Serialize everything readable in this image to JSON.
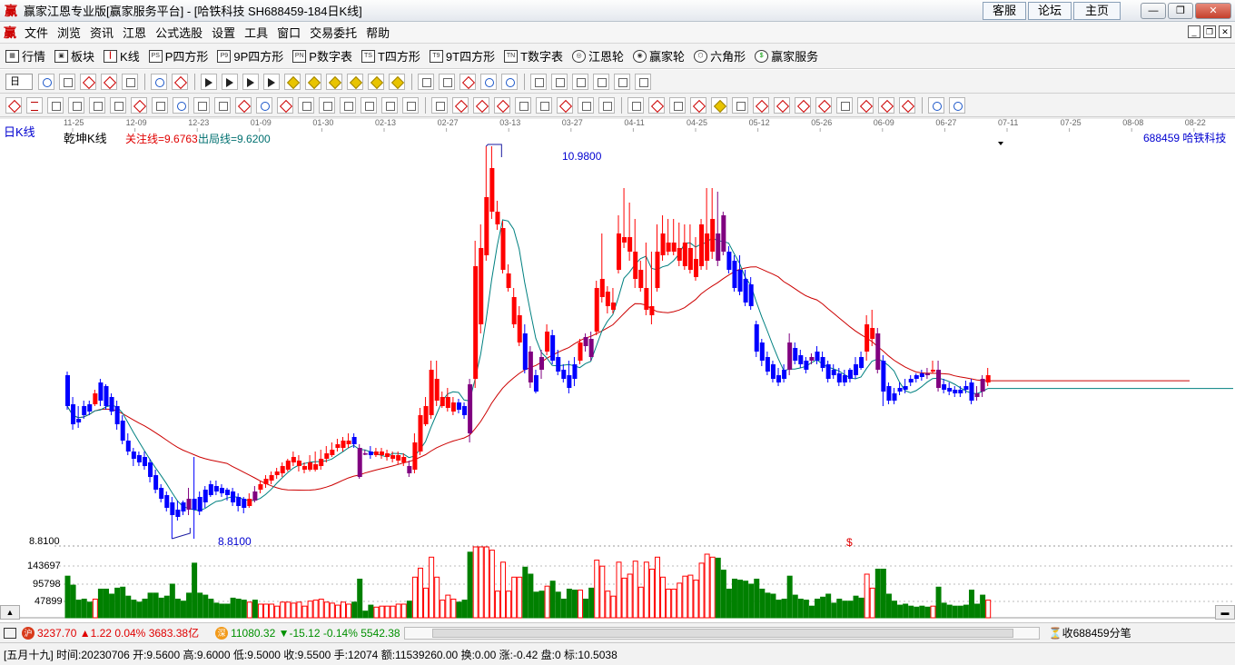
{
  "window": {
    "title": "赢家江恩专业版[赢家服务平台] - [哈铁科技  SH688459-184日K线]",
    "links": [
      "客服",
      "论坛",
      "主页"
    ]
  },
  "menu": [
    "文件",
    "浏览",
    "资讯",
    "江恩",
    "公式选股",
    "设置",
    "工具",
    "窗口",
    "交易委托",
    "帮助"
  ],
  "nav": [
    {
      "label": "行情",
      "icon": "grid-icon"
    },
    {
      "label": "板块",
      "icon": "blocks-icon"
    },
    {
      "label": "K线",
      "icon": "kline-icon"
    },
    {
      "label": "P四方形",
      "icon": "ps-icon"
    },
    {
      "label": "9P四方形",
      "icon": "p9-icon"
    },
    {
      "label": "P数字表",
      "icon": "pn-icon"
    },
    {
      "label": "T四方形",
      "icon": "ts-icon"
    },
    {
      "label": "9T四方形",
      "icon": "t9-icon"
    },
    {
      "label": "T数字表",
      "icon": "tn-icon"
    },
    {
      "label": "江恩轮",
      "icon": "gann-wheel-icon"
    },
    {
      "label": "赢家轮",
      "icon": "winner-wheel-icon"
    },
    {
      "label": "六角形",
      "icon": "hexagon-icon"
    },
    {
      "label": "赢家服务",
      "icon": "dollar-icon"
    }
  ],
  "toolbar": {
    "period_select": "日"
  },
  "chart": {
    "period_label": "日K线",
    "indicator_name": "乾坤K线",
    "focus_line": "关注线=9.6763",
    "exit_line": "出局线=9.6200",
    "stock_label": "688459  哈铁科技",
    "high_label": "10.9800",
    "low_label": "8.8100",
    "low_price_axis": "8.8100",
    "vol_ticks": [
      "143697",
      "95798",
      "47899"
    ],
    "dollar_mark": "$",
    "date_ticks": [
      "11-25",
      "12-09",
      "12-23",
      "01-09",
      "01-30",
      "02-13",
      "02-27",
      "03-13",
      "03-27",
      "04-11",
      "04-25",
      "05-12",
      "05-26",
      "06-09",
      "06-27",
      "07-11",
      "07-25",
      "08-08",
      "08-22"
    ]
  },
  "colors": {
    "up": "#ff0000",
    "down": "#0000ff",
    "flat": "#800080",
    "vol_up": "#ff0000",
    "vol_down": "#008000",
    "ma1": "#cc0000",
    "ma2": "#008080"
  },
  "status": {
    "sh_index": "3237.70",
    "sh_change": "▲1.22",
    "sh_pct": "0.04%",
    "sh_amount": "3683.38亿",
    "sz_index": "11080.32",
    "sz_change": "▼-15.12",
    "sz_pct": "-0.14%",
    "sz_amount": "5542.38",
    "tick_text": "收688459分笔"
  },
  "info": {
    "lunar": "[五月十九]",
    "time": "时间:20230706",
    "open": "开:9.5600",
    "high": "高:9.6000",
    "low": "低:9.5000",
    "close": "收:9.5500",
    "volume": "手:12074",
    "amount": "额:11539260.00",
    "turnover": "换:0.00",
    "change": "涨:-0.42",
    "board": "盘:0",
    "mark": "标:10.5038"
  },
  "chart_data": {
    "type": "candlestick",
    "price_high": 10.98,
    "price_low": 8.81,
    "candles": [
      [
        "d",
        9.72,
        9.55,
        9.74,
        9.53
      ],
      [
        "d",
        9.56,
        9.45,
        9.6,
        9.42
      ],
      [
        "d",
        9.48,
        9.46,
        9.55,
        9.43
      ],
      [
        "d",
        9.55,
        9.5,
        9.58,
        9.48
      ],
      [
        "d",
        9.52,
        9.56,
        9.58,
        9.5
      ],
      [
        "u",
        9.56,
        9.62,
        9.64,
        9.55
      ],
      [
        "d",
        9.68,
        9.58,
        9.7,
        9.55
      ],
      [
        "d",
        9.66,
        9.55,
        9.67,
        9.53
      ],
      [
        "d",
        9.6,
        9.52,
        9.62,
        9.5
      ],
      [
        "d",
        9.55,
        9.45,
        9.58,
        9.42
      ],
      [
        "d",
        9.47,
        9.36,
        9.5,
        9.34
      ],
      [
        "d",
        9.36,
        9.3,
        9.4,
        9.28
      ],
      [
        "d",
        9.3,
        9.26,
        9.32,
        9.22
      ],
      [
        "d",
        9.28,
        9.24,
        9.3,
        9.22
      ],
      [
        "d",
        9.27,
        9.22,
        9.3,
        9.2
      ],
      [
        "d",
        9.24,
        9.16,
        9.26,
        9.13
      ],
      [
        "d",
        9.17,
        9.09,
        9.2,
        9.07
      ],
      [
        "d",
        9.1,
        9.04,
        9.12,
        9.02
      ],
      [
        "d",
        9.06,
        8.99,
        9.08,
        8.97
      ],
      [
        "d",
        9.02,
        8.95,
        9.05,
        8.82
      ],
      [
        "d",
        8.98,
        8.94,
        9.03,
        8.92
      ],
      [
        "d",
        9.02,
        8.97,
        9.03,
        8.95
      ],
      [
        "p",
        8.98,
        9.04,
        9.1,
        8.95
      ],
      [
        "d",
        9.04,
        8.98,
        9.27,
        8.82
      ],
      [
        "d",
        9.05,
        8.97,
        9.08,
        8.95
      ],
      [
        "d",
        9.09,
        9.02,
        9.11,
        8.99
      ],
      [
        "d",
        9.12,
        9.06,
        9.14,
        9.05
      ],
      [
        "d",
        9.11,
        9.08,
        9.14,
        9.06
      ],
      [
        "d",
        9.1,
        9.07,
        9.12,
        9.05
      ],
      [
        "d",
        9.09,
        9.06,
        9.1,
        9.03
      ],
      [
        "d",
        9.08,
        9.02,
        9.1,
        9.0
      ],
      [
        "d",
        9.05,
        9.0,
        9.07,
        8.97
      ],
      [
        "d",
        9.04,
        8.99,
        9.05,
        8.96
      ],
      [
        "u",
        9.0,
        9.04,
        9.07,
        8.99
      ],
      [
        "p",
        9.03,
        9.08,
        9.11,
        9.02
      ],
      [
        "u",
        9.09,
        9.12,
        9.14,
        9.07
      ],
      [
        "u",
        9.12,
        9.15,
        9.17,
        9.1
      ],
      [
        "u",
        9.14,
        9.17,
        9.19,
        9.12
      ],
      [
        "u",
        9.17,
        9.19,
        9.21,
        9.15
      ],
      [
        "u",
        9.18,
        9.22,
        9.24,
        9.16
      ],
      [
        "u",
        9.2,
        9.25,
        9.26,
        9.19
      ],
      [
        "u",
        9.24,
        9.27,
        9.3,
        9.22
      ],
      [
        "u",
        9.22,
        9.25,
        9.28,
        9.19
      ],
      [
        "u",
        9.2,
        9.22,
        9.24,
        9.18
      ],
      [
        "u",
        9.2,
        9.24,
        9.28,
        9.19
      ],
      [
        "u",
        9.2,
        9.23,
        9.3,
        9.19
      ],
      [
        "u",
        9.22,
        9.26,
        9.31,
        9.2
      ],
      [
        "u",
        9.26,
        9.29,
        9.33,
        9.24
      ],
      [
        "u",
        9.28,
        9.31,
        9.35,
        9.27
      ],
      [
        "u",
        9.32,
        9.34,
        9.37,
        9.3
      ],
      [
        "u",
        9.32,
        9.36,
        9.38,
        9.3
      ],
      [
        "u",
        9.34,
        9.36,
        9.4,
        9.32
      ],
      [
        "d",
        9.38,
        9.34,
        9.4,
        9.32
      ],
      [
        "p",
        9.32,
        9.16,
        9.34,
        9.15
      ],
      [
        "p",
        9.29,
        9.29,
        9.31,
        9.28
      ],
      [
        "d",
        9.3,
        9.28,
        9.33,
        9.26
      ],
      [
        "u",
        9.28,
        9.3,
        9.32,
        9.27
      ],
      [
        "u",
        9.28,
        9.3,
        9.32,
        9.26
      ],
      [
        "u",
        9.27,
        9.29,
        9.31,
        9.25
      ],
      [
        "u",
        9.26,
        9.28,
        9.3,
        9.24
      ],
      [
        "u",
        9.25,
        9.28,
        9.3,
        9.23
      ],
      [
        "u",
        9.24,
        9.27,
        9.29,
        9.22
      ],
      [
        "p",
        9.22,
        9.18,
        9.25,
        9.16
      ],
      [
        "u",
        9.2,
        9.35,
        9.4,
        9.18
      ],
      [
        "u",
        9.3,
        9.5,
        9.54,
        9.28
      ],
      [
        "u",
        9.45,
        9.55,
        9.6,
        9.44
      ],
      [
        "u",
        9.5,
        9.75,
        9.8,
        9.48
      ],
      [
        "u",
        9.58,
        9.7,
        9.8,
        9.55
      ],
      [
        "u",
        9.55,
        9.6,
        9.63,
        9.54
      ],
      [
        "u",
        9.54,
        9.6,
        9.65,
        9.52
      ],
      [
        "u",
        9.52,
        9.57,
        9.6,
        9.5
      ],
      [
        "d",
        9.57,
        9.53,
        9.59,
        9.51
      ],
      [
        "d",
        9.55,
        9.5,
        9.57,
        9.48
      ],
      [
        "p",
        9.4,
        9.67,
        9.7,
        9.35
      ],
      [
        "u",
        9.7,
        10.32,
        10.46,
        9.65
      ],
      [
        "u",
        10.0,
        10.42,
        10.55,
        9.95
      ],
      [
        "u",
        10.38,
        10.7,
        10.98,
        10.35
      ],
      [
        "u",
        10.62,
        10.86,
        10.98,
        10.58
      ],
      [
        "u",
        10.55,
        10.62,
        10.68,
        10.52
      ],
      [
        "u",
        10.3,
        10.53,
        10.57,
        10.28
      ],
      [
        "u",
        10.2,
        10.28,
        10.33,
        10.18
      ],
      [
        "u",
        10.0,
        10.15,
        10.2,
        9.98
      ],
      [
        "u",
        9.9,
        10.05,
        10.1,
        9.88
      ],
      [
        "d",
        9.95,
        9.75,
        10.0,
        9.73
      ],
      [
        "p",
        9.85,
        9.68,
        9.88,
        9.65
      ],
      [
        "d",
        9.72,
        9.63,
        9.75,
        9.62
      ],
      [
        "p",
        9.75,
        9.82,
        9.86,
        9.7
      ],
      [
        "u",
        9.85,
        9.96,
        10.0,
        9.83
      ],
      [
        "d",
        9.94,
        9.8,
        9.97,
        9.78
      ],
      [
        "d",
        9.82,
        9.74,
        9.86,
        9.72
      ],
      [
        "d",
        9.75,
        9.7,
        9.78,
        9.68
      ],
      [
        "d",
        9.72,
        9.65,
        9.8,
        9.62
      ],
      [
        "d",
        9.7,
        9.78,
        9.82,
        9.66
      ],
      [
        "u",
        9.8,
        9.9,
        9.92,
        9.78
      ],
      [
        "p",
        9.88,
        9.93,
        9.95,
        9.85
      ],
      [
        "p",
        9.92,
        9.82,
        9.96,
        9.8
      ],
      [
        "u",
        9.96,
        10.2,
        10.24,
        9.94
      ],
      [
        "u",
        10.25,
        10.15,
        10.5,
        10.12
      ],
      [
        "u",
        10.18,
        10.1,
        10.21,
        10.06
      ],
      [
        "u",
        10.08,
        10.12,
        10.2,
        10.06
      ],
      [
        "u",
        10.3,
        10.5,
        10.6,
        10.28
      ],
      [
        "u",
        10.48,
        10.45,
        10.75,
        10.42
      ],
      [
        "u",
        10.48,
        10.4,
        10.67,
        10.35
      ],
      [
        "u",
        10.25,
        10.4,
        10.58,
        10.2
      ],
      [
        "u",
        10.2,
        10.3,
        10.35,
        10.18
      ],
      [
        "u",
        10.08,
        10.2,
        10.45,
        10.05
      ],
      [
        "u",
        10.05,
        10.1,
        10.4,
        10.0
      ],
      [
        "u",
        10.2,
        10.4,
        10.55,
        10.18
      ],
      [
        "u",
        10.38,
        10.5,
        10.6,
        10.35
      ],
      [
        "u",
        10.4,
        10.45,
        10.58,
        10.38
      ],
      [
        "u",
        10.4,
        10.45,
        10.58,
        10.38
      ],
      [
        "u",
        10.35,
        10.42,
        10.56,
        10.32
      ],
      [
        "u",
        10.32,
        10.45,
        10.55,
        10.3
      ],
      [
        "u",
        10.3,
        10.42,
        10.55,
        10.28
      ],
      [
        "u",
        10.26,
        10.36,
        10.48,
        10.24
      ],
      [
        "u",
        10.32,
        10.55,
        10.58,
        10.3
      ],
      [
        "u",
        10.35,
        10.5,
        10.75,
        10.3
      ],
      [
        "u",
        10.4,
        10.58,
        10.75,
        10.36
      ],
      [
        "p",
        10.5,
        10.35,
        10.73,
        10.32
      ],
      [
        "p",
        10.6,
        10.4,
        10.62,
        10.38
      ],
      [
        "d",
        10.4,
        10.3,
        10.43,
        10.28
      ],
      [
        "d",
        10.35,
        10.2,
        10.38,
        10.18
      ],
      [
        "d",
        10.3,
        10.18,
        10.38,
        10.16
      ],
      [
        "d",
        10.25,
        10.12,
        10.3,
        10.1
      ],
      [
        "d",
        10.22,
        10.1,
        10.26,
        10.08
      ],
      [
        "d",
        10.0,
        9.85,
        10.02,
        9.82
      ],
      [
        "d",
        9.9,
        9.8,
        9.92,
        9.77
      ],
      [
        "d",
        9.82,
        9.74,
        9.85,
        9.72
      ],
      [
        "d",
        9.78,
        9.7,
        9.8,
        9.68
      ],
      [
        "d",
        9.72,
        9.68,
        9.76,
        9.66
      ],
      [
        "d",
        9.75,
        9.7,
        9.78,
        9.68
      ],
      [
        "p",
        9.75,
        9.9,
        9.95,
        9.72
      ],
      [
        "d",
        9.87,
        9.8,
        9.9,
        9.78
      ],
      [
        "d",
        9.83,
        9.78,
        9.86,
        9.76
      ],
      [
        "d",
        9.8,
        9.75,
        9.82,
        9.73
      ],
      [
        "p",
        9.82,
        9.8,
        9.84,
        9.78
      ],
      [
        "d",
        9.85,
        9.8,
        9.88,
        9.78
      ],
      [
        "d",
        9.82,
        9.76,
        9.85,
        9.74
      ],
      [
        "d",
        9.78,
        9.7,
        9.8,
        9.68
      ],
      [
        "d",
        9.75,
        9.72,
        9.78,
        9.7
      ],
      [
        "d",
        9.73,
        9.68,
        9.76,
        9.66
      ],
      [
        "d",
        9.72,
        9.68,
        9.75,
        9.66
      ],
      [
        "d",
        9.75,
        9.7,
        9.76,
        9.68
      ],
      [
        "d",
        9.78,
        9.72,
        9.82,
        9.7
      ],
      [
        "d",
        9.82,
        9.76,
        9.85,
        9.75
      ],
      [
        "u",
        9.85,
        10.0,
        10.05,
        9.8
      ],
      [
        "u",
        9.98,
        9.92,
        10.08,
        9.88
      ],
      [
        "p",
        9.95,
        9.75,
        9.98,
        9.73
      ],
      [
        "d",
        9.8,
        9.63,
        9.83,
        9.55
      ],
      [
        "d",
        9.66,
        9.58,
        9.68,
        9.56
      ],
      [
        "d",
        9.62,
        9.58,
        9.65,
        9.56
      ],
      [
        "d",
        9.65,
        9.63,
        9.68,
        9.61
      ],
      [
        "d",
        9.66,
        9.64,
        9.7,
        9.62
      ],
      [
        "d",
        9.7,
        9.68,
        9.72,
        9.66
      ],
      [
        "d",
        9.72,
        9.7,
        9.73,
        9.68
      ],
      [
        "d",
        9.73,
        9.71,
        9.75,
        9.69
      ],
      [
        "p",
        9.72,
        9.73,
        9.76,
        9.7
      ],
      [
        "u",
        9.74,
        9.75,
        9.8,
        9.73
      ],
      [
        "p",
        9.75,
        9.65,
        9.8,
        9.63
      ],
      [
        "d",
        9.67,
        9.64,
        9.7,
        9.62
      ],
      [
        "d",
        9.65,
        9.63,
        9.68,
        9.61
      ],
      [
        "d",
        9.64,
        9.62,
        9.66,
        9.6
      ],
      [
        "d",
        9.64,
        9.62,
        9.66,
        9.6
      ],
      [
        "d",
        9.66,
        9.64,
        9.69,
        9.62
      ],
      [
        "d",
        9.68,
        9.58,
        9.7,
        9.56
      ],
      [
        "p",
        9.6,
        9.62,
        9.66,
        9.58
      ],
      [
        "p",
        9.63,
        9.7,
        9.72,
        9.6
      ],
      [
        "u",
        9.68,
        9.72,
        9.76,
        9.66
      ]
    ]
  }
}
